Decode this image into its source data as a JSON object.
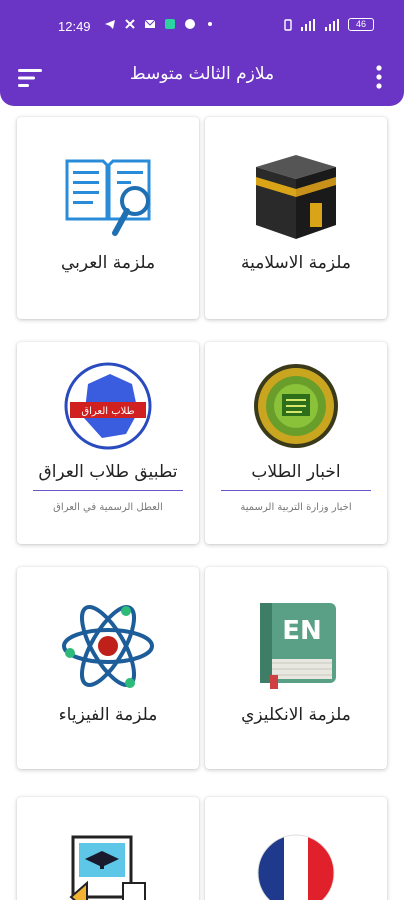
{
  "status_bar": {
    "time": "12:49",
    "battery": "46"
  },
  "toolbar": {
    "title": "ملازم الثالث متوسط",
    "menu_icon": "menu-icon",
    "more_icon": "more-vert-icon",
    "color": "#6a35c4"
  },
  "cards": [
    {
      "label": "ملزمة الاسلامية",
      "icon": "kaaba-icon"
    },
    {
      "label": "ملزمة العربي",
      "icon": "book-search-icon"
    },
    {
      "label": "اخبار الطلاب",
      "subtitle": "اخبار وزارة التربية الرسمية",
      "icon": "ministry-seal-icon"
    },
    {
      "label": "تطبيق طلاب العراق",
      "subtitle": "العطل الرسمية في العراق",
      "icon": "iraq-students-icon",
      "icon_text": "طلاب العراق"
    },
    {
      "label": "ملزمة الانكليزي",
      "icon": "english-book-icon",
      "icon_text": "EN"
    },
    {
      "label": "ملزمة الفيزياء",
      "icon": "atom-icon"
    },
    {
      "label": "",
      "icon": "france-flag-icon"
    },
    {
      "label": "",
      "icon": "graduation-document-icon"
    }
  ]
}
